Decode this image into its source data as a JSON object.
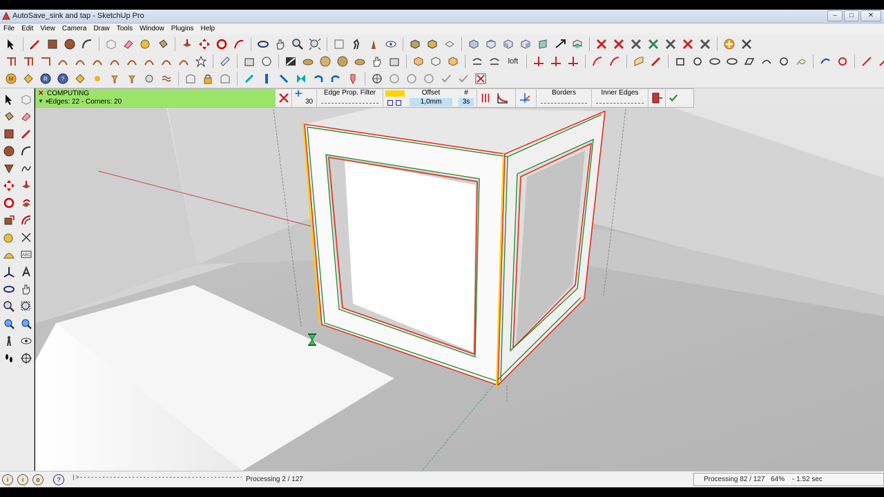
{
  "window": {
    "title": "AutoSave_sink and tap - SketchUp Pro",
    "minimize": "–",
    "maximize": "□",
    "close": "✕"
  },
  "menu": [
    "File",
    "Edit",
    "View",
    "Camera",
    "Draw",
    "Tools",
    "Window",
    "Plugins",
    "Help"
  ],
  "toolbar": {
    "loft_label": "loft"
  },
  "plugin_bar": {
    "computing": "COMPUTING",
    "status": "Edges: 22 - Corners: 20",
    "angle_value": "30",
    "edge_filter_label": "Edge Prop. Filter",
    "offset_label": "Offset",
    "offset_value": "1,0mm",
    "count_label": "#",
    "count_value": "3s",
    "borders_label": "Borders",
    "inner_edges_label": "Inner Edges",
    "colors": {
      "status_bg": "#9be46a",
      "accent": "#ffd400"
    }
  },
  "statusbar": {
    "progress_track": "|>-----------------------------------------------|",
    "processing_left": "Processing 2 / 127",
    "processing_right": "Processing 82 / 127",
    "percent": "64%",
    "elapsed": "- 1.52 sec"
  },
  "icons": {
    "select": "arrow-icon",
    "hourglass": "hourglass-icon",
    "accept": "checkmark-icon",
    "cancel": "x-icon"
  }
}
